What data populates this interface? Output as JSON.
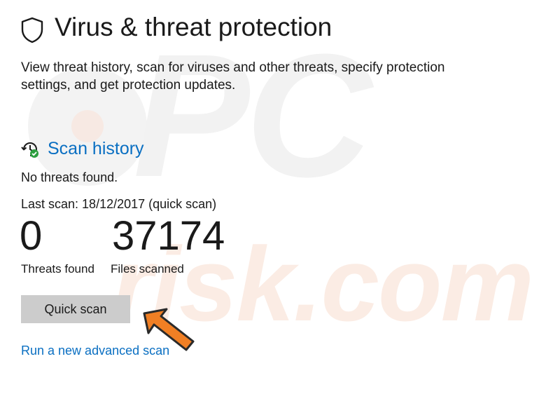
{
  "header": {
    "title": "Virus & threat protection",
    "description": "View threat history, scan for viruses and other threats, specify protection settings, and get protection updates."
  },
  "scan_history": {
    "link_label": "Scan history",
    "status": "No threats found.",
    "last_scan": "Last scan: 18/12/2017 (quick scan)",
    "threats_found_value": "0",
    "threats_found_label": "Threats found",
    "files_scanned_value": "37174",
    "files_scanned_label": "Files scanned"
  },
  "actions": {
    "quick_scan_label": "Quick scan",
    "advanced_scan_label": "Run a new advanced scan"
  },
  "watermark": {
    "line1": "PC",
    "line2": "risk.com"
  },
  "colors": {
    "link": "#0a6fc2",
    "button_bg": "#cccccc",
    "arrow": "#f07f24",
    "check_badge": "#2c9e3f"
  },
  "icons": {
    "title": "shield-icon",
    "history": "history-clock-icon",
    "pointer": "arrow-pointer-icon"
  }
}
